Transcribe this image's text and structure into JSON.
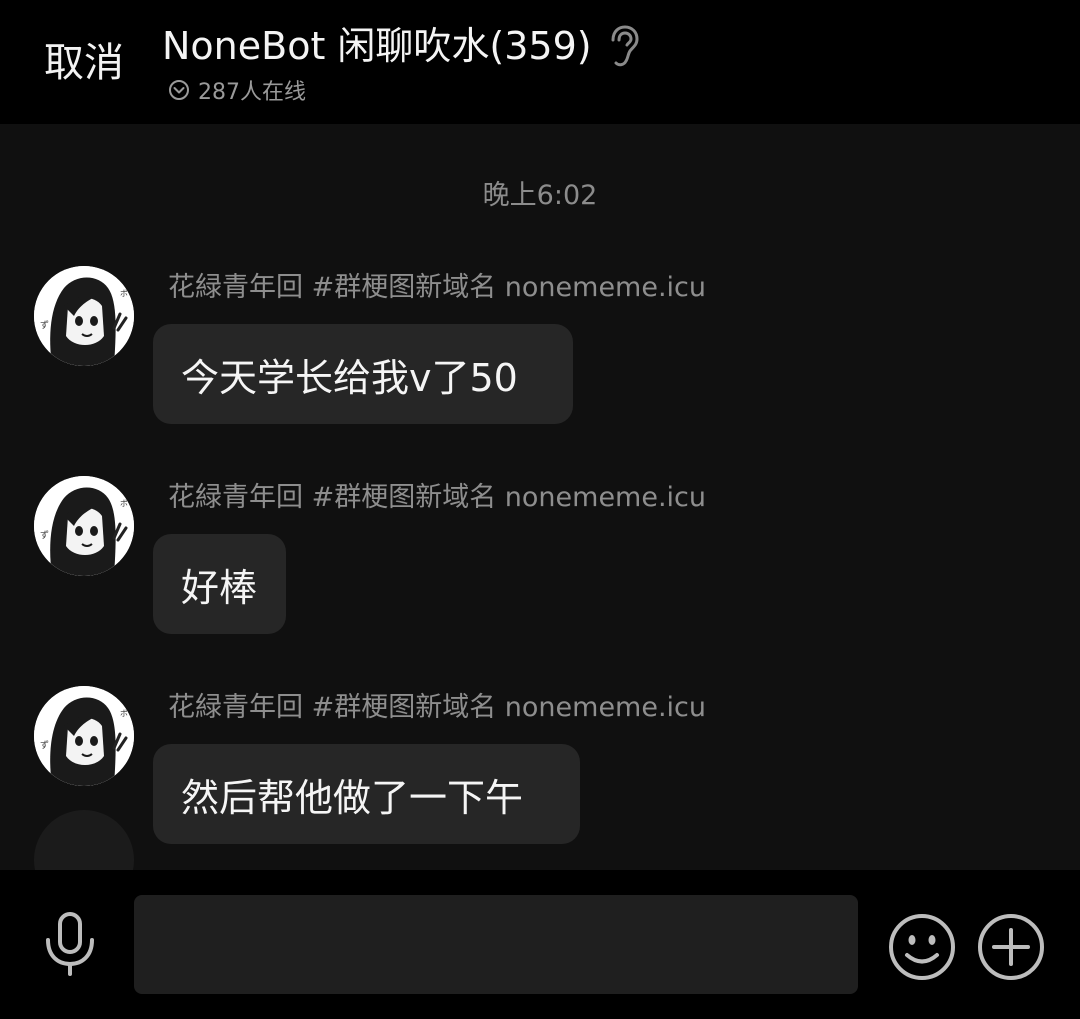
{
  "header": {
    "cancel_label": "取消",
    "group_title": "NoneBot 闲聊吹水(359)",
    "online_text": "287人在线"
  },
  "timestamp": "晚上6:02",
  "messages": [
    {
      "sender": "花緑青年回 #群梗图新域名 nonememe.icu",
      "text": "今天学长给我v了50"
    },
    {
      "sender": "花緑青年回 #群梗图新域名 nonememe.icu",
      "text": "好棒"
    },
    {
      "sender": "花緑青年回 #群梗图新域名 nonememe.icu",
      "text": "然后帮他做了一下午"
    }
  ],
  "input": {
    "value": "",
    "placeholder": ""
  },
  "icons": {
    "ear": "ear-icon",
    "online": "chevron-down-circle-icon",
    "mic": "microphone-icon",
    "emoji": "smiley-icon",
    "plus": "plus-circle-icon"
  },
  "colors": {
    "background": "#101010",
    "header": "#000000",
    "bubble": "#262626",
    "secondary_text": "#8e8e8e",
    "input_field": "#1f1f1f"
  }
}
